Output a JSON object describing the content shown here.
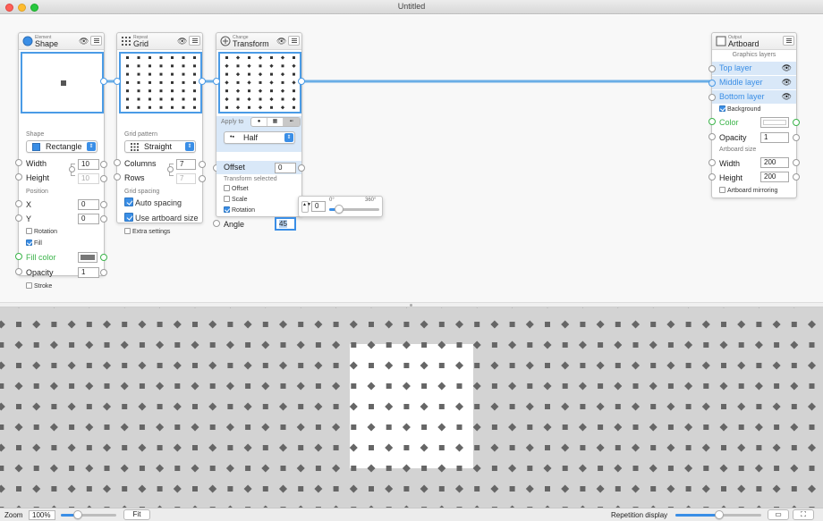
{
  "window": {
    "title": "Untitled"
  },
  "colors": {
    "accent": "#3a8ee6",
    "connection": "#6aaee6",
    "fill": "#777777",
    "canvas_bg": "#d3d3d3",
    "pattern": "#666666"
  },
  "nodes": {
    "shape": {
      "category": "Element",
      "name": "Shape",
      "icon": "circle-element-icon",
      "shape_label": "Shape",
      "shape_value": "Rectangle",
      "width_label": "Width",
      "width_value": "10",
      "height_label": "Height",
      "height_value": "10",
      "position_label": "Position",
      "x_label": "X",
      "x_value": "0",
      "y_label": "Y",
      "y_value": "0",
      "rotation_label": "Rotation",
      "fill_label": "Fill",
      "fill_color_label": "Fill color",
      "opacity_label": "Opacity",
      "opacity_value": "1",
      "stroke_label": "Stroke"
    },
    "grid": {
      "category": "Repeat",
      "name": "Grid",
      "icon": "grid-repeat-icon",
      "pattern_label": "Grid pattern",
      "pattern_value": "Straight",
      "columns_label": "Columns",
      "columns_value": "7",
      "rows_label": "Rows",
      "rows_value": "7",
      "spacing_label": "Grid spacing",
      "auto_spacing_label": "Auto spacing",
      "use_artboard_label": "Use artboard size",
      "extra_label": "Extra settings"
    },
    "transform": {
      "category": "Change",
      "name": "Transform",
      "icon": "transform-change-icon",
      "apply_label": "Apply to",
      "mode_value": "Half",
      "offset_label": "Offset",
      "offset_value": "0",
      "selected_label": "Transform selected",
      "offset_chk_label": "Offset",
      "scale_label": "Scale",
      "rotation_label": "Rotation",
      "angle_label": "Angle",
      "angle_value": "45"
    },
    "angle_popup": {
      "value": "0",
      "min_label": "0°",
      "max_label": "360°"
    },
    "artboard": {
      "category": "Output",
      "name": "Artboard",
      "icon": "artboard-output-icon",
      "layers_label": "Graphics layers",
      "layers": [
        "Top layer",
        "Middle layer",
        "Bottom layer"
      ],
      "background_label": "Background",
      "color_label": "Color",
      "opacity_label": "Opacity",
      "opacity_value": "1",
      "size_label": "Artboard size",
      "width_label": "Width",
      "width_value": "200",
      "height_label": "Height",
      "height_value": "200",
      "mirroring_label": "Artboard mirroring"
    }
  },
  "statusbar": {
    "zoom_label": "Zoom",
    "zoom_value": "100%",
    "fit_label": "Fit",
    "repetition_label": "Repetition display"
  }
}
